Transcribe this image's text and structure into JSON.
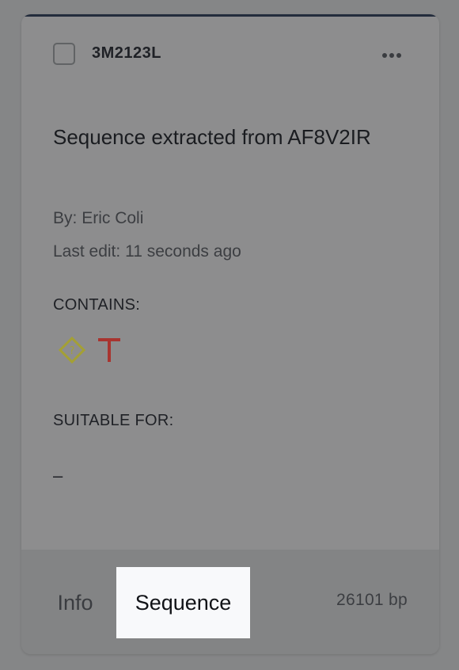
{
  "card": {
    "id_label": "3M2123L",
    "title": "Sequence extracted from AF8V2IR",
    "author_prefix": "By:",
    "author": "Eric Coli",
    "edit_prefix": "Last edit:",
    "edit_value": "11 seconds ago",
    "contains_label": "CONTAINS:",
    "contains_icons": [
      "unknown-feature-diamond-icon",
      "terminator-t-icon"
    ],
    "suitable_label": "SUITABLE FOR:",
    "suitable_value": "–"
  },
  "footer": {
    "tabs": [
      {
        "label": "Info",
        "active": false
      },
      {
        "label": "Sequence",
        "active": true
      }
    ],
    "bp_count": "26101 bp"
  },
  "colors": {
    "diamond_icon": "#a4a034",
    "terminator_icon": "#a8342f",
    "active_tab_bg": "#f8f9fb",
    "top_bar": "#232c3c"
  }
}
